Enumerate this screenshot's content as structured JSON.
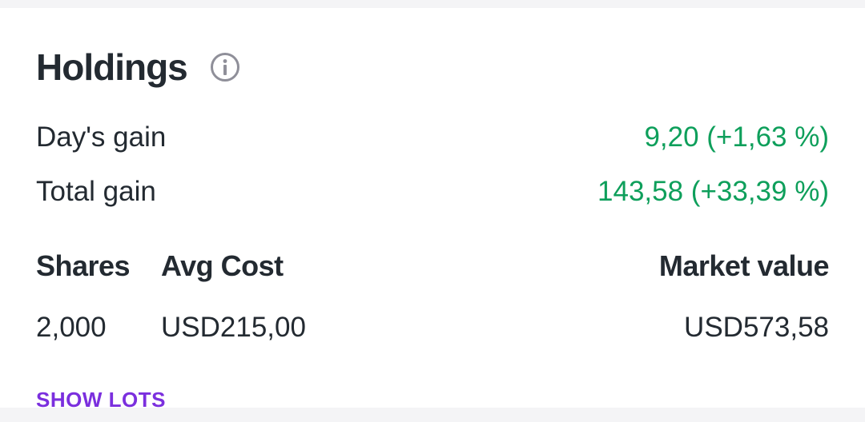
{
  "holdings": {
    "title": "Holdings",
    "info_icon": "info-icon",
    "days_gain": {
      "label": "Day's gain",
      "value": "9,20 (+1,63 %)"
    },
    "total_gain": {
      "label": "Total gain",
      "value": "143,58 (+33,39 %)"
    },
    "columns": {
      "shares": {
        "label": "Shares",
        "value": "2,000"
      },
      "avg_cost": {
        "label": "Avg Cost",
        "value": "USD215,00"
      },
      "market_value": {
        "label": "Market value",
        "value": "USD573,58"
      }
    },
    "show_lots_label": "SHOW LOTS"
  },
  "colors": {
    "gain": "#0e9f5b",
    "accent": "#7b2fde",
    "text": "#232a31",
    "icon": "#8f8f99"
  }
}
